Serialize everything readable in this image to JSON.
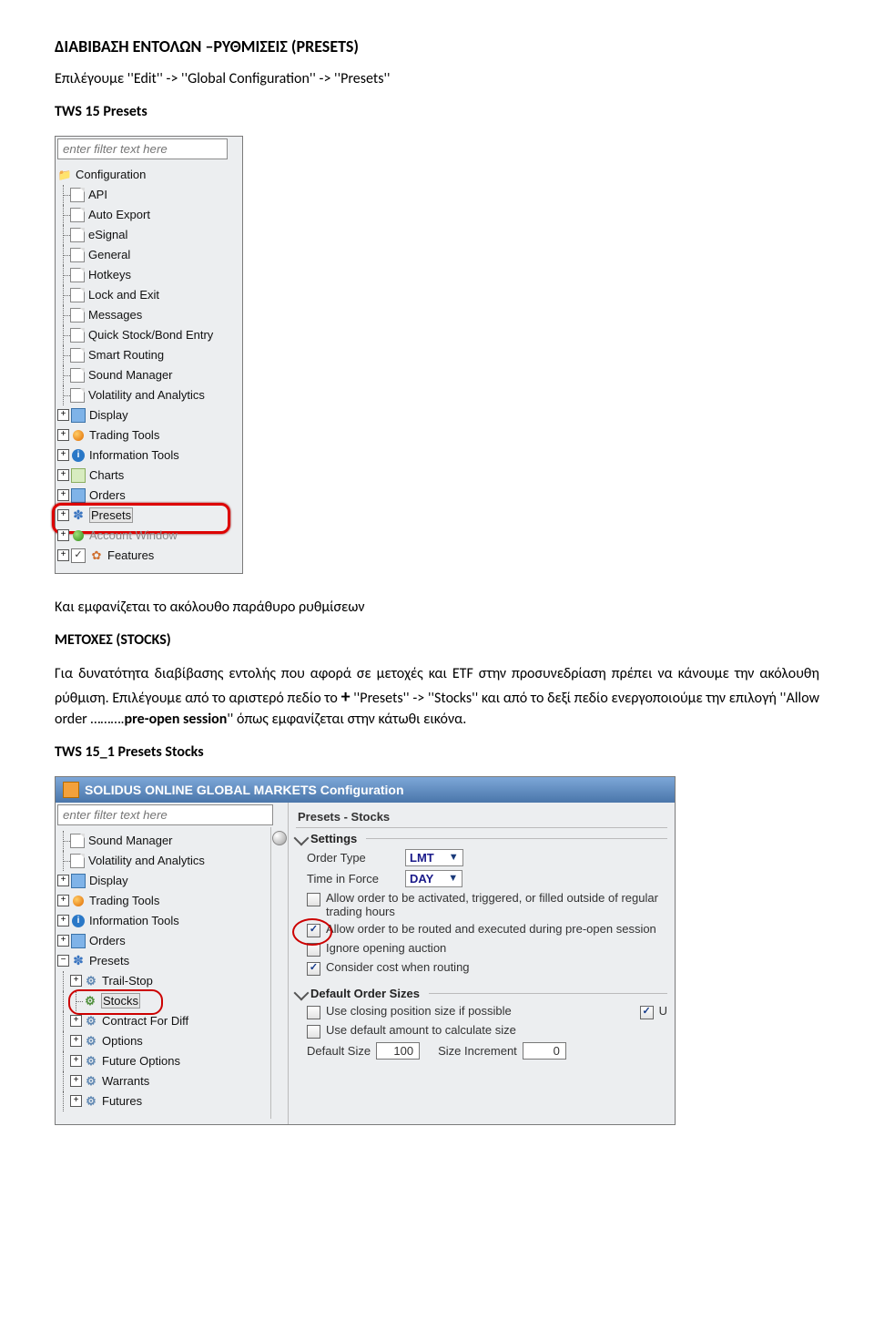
{
  "doc": {
    "title": "ΔΙΑΒΙΒΑΣΗ ΕΝΤΟΛΩΝ –ΡΥΘΜΙΣΕΙΣ (PRESETS)",
    "para1": "Επιλέγουμε ''Edit'' -> ''Global  Configuration'' -> ''Presets''",
    "caption1": "TWS 15 Presets",
    "para2": "Και εμφανίζεται το ακόλουθο παράθυρο ρυθμίσεων",
    "heading2": "ΜΕΤΟΧΕΣ (STOCKS)",
    "para3_a": "Για δυνατότητα διαβίβασης εντολής που αφορά σε μετοχές και ETF στην προσυνεδρίαση πρέπει να κάνουμε την ακόλουθη ρύθμιση. Επιλέγουμε από το αριστερό πεδίο το ",
    "plus": "+",
    "para3_b": "''Presets'' -> ''Stocks'' και από το δεξί πεδίο  ενεργοποιούμε  την  επιλογή  ''Allow  order  ……….",
    "para3_c": "pre-open  session",
    "para3_d": "''  όπως  εμφανίζεται  στην κάτωθι εικόνα.",
    "caption2": "TWS 15_1 Presets Stocks"
  },
  "shot1": {
    "filter_placeholder": "enter filter text here",
    "root": "Configuration",
    "items": [
      "API",
      "Auto Export",
      "eSignal",
      "General",
      "Hotkeys",
      "Lock and Exit",
      "Messages",
      "Quick Stock/Bond Entry",
      "Smart Routing",
      "Sound Manager",
      "Volatility and Analytics"
    ],
    "branches": [
      {
        "label": "Display",
        "icon": "blue-sq"
      },
      {
        "label": "Trading Tools",
        "icon": "orange-ball"
      },
      {
        "label": "Information Tools",
        "icon": "info"
      },
      {
        "label": "Charts",
        "icon": "green"
      },
      {
        "label": "Orders",
        "icon": "blue-sq"
      },
      {
        "label": "Presets",
        "icon": "paw",
        "selected": true
      },
      {
        "label": "Account Window",
        "icon": "green-ball",
        "muted": true
      },
      {
        "label": "Features",
        "icon": "check-flower"
      }
    ]
  },
  "shot2": {
    "window_title": "SOLIDUS ONLINE GLOBAL MARKETS Configuration",
    "filter_placeholder": "enter filter text here",
    "left_items": [
      {
        "label": "Sound Manager",
        "icon": "page",
        "exp": "-",
        "depth": 0
      },
      {
        "label": "Volatility and Analytics",
        "icon": "page",
        "exp": "-",
        "depth": 0
      },
      {
        "label": "Display",
        "icon": "blue-sq",
        "exp": "+",
        "depth": 0
      },
      {
        "label": "Trading Tools",
        "icon": "orange-ball",
        "exp": "+",
        "depth": 0
      },
      {
        "label": "Information Tools",
        "icon": "info",
        "exp": "+",
        "depth": 0
      },
      {
        "label": "Orders",
        "icon": "blue-sq",
        "exp": "+",
        "depth": 0
      },
      {
        "label": "Presets",
        "icon": "paw",
        "exp": "-",
        "depth": 0
      },
      {
        "label": "Trail-Stop",
        "icon": "gear",
        "exp": "+",
        "depth": 1
      },
      {
        "label": "Stocks",
        "icon": "gear-green",
        "exp": "",
        "depth": 1,
        "selected": true
      },
      {
        "label": "Contract For Diff",
        "icon": "gear",
        "exp": "+",
        "depth": 1
      },
      {
        "label": "Options",
        "icon": "gear",
        "exp": "+",
        "depth": 1
      },
      {
        "label": "Future Options",
        "icon": "gear",
        "exp": "+",
        "depth": 1
      },
      {
        "label": "Warrants",
        "icon": "gear",
        "exp": "+",
        "depth": 1
      },
      {
        "label": "Futures",
        "icon": "gear",
        "exp": "+",
        "depth": 1
      }
    ],
    "right": {
      "title": "Presets - Stocks",
      "settings_label": "Settings",
      "order_type_label": "Order Type",
      "order_type_value": "LMT",
      "tif_label": "Time in Force",
      "tif_value": "DAY",
      "opt1": "Allow order to be activated, triggered, or filled outside of regular trading hours",
      "opt2": "Allow order to be routed and executed during pre-open session",
      "opt3": "Ignore opening auction",
      "opt4": "Consider cost when routing",
      "sizes_label": "Default Order Sizes",
      "use_closing": "Use closing position size if possible",
      "u_trail": "U",
      "use_default_amount": "Use default amount to calculate size",
      "default_size_label": "Default Size",
      "default_size_value": "100",
      "size_incr_label": "Size Increment",
      "size_incr_value": "0"
    }
  }
}
